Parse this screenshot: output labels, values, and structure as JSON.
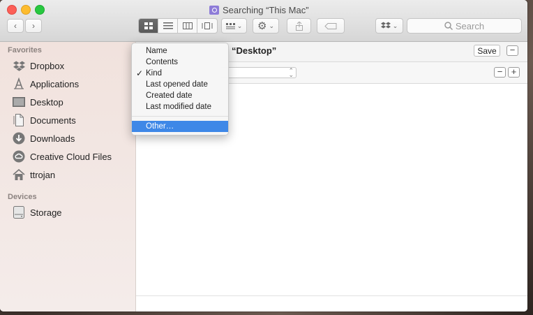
{
  "window": {
    "title": "Searching “This Mac”"
  },
  "toolbar": {
    "search_placeholder": "Search",
    "icons": [
      "back-icon",
      "forward-icon",
      "icon-view-icon",
      "list-view-icon",
      "column-view-icon",
      "coverflow-view-icon",
      "arrange-icon",
      "action-gear-icon",
      "share-icon",
      "tag-icon",
      "dropbox-icon",
      "search-icon"
    ]
  },
  "sidebar": {
    "favorites_label": "Favorites",
    "favorites": [
      {
        "label": "Dropbox",
        "icon": "dropbox-icon"
      },
      {
        "label": "Applications",
        "icon": "applications-icon"
      },
      {
        "label": "Desktop",
        "icon": "desktop-icon"
      },
      {
        "label": "Documents",
        "icon": "documents-icon"
      },
      {
        "label": "Downloads",
        "icon": "downloads-icon"
      },
      {
        "label": "Creative Cloud Files",
        "icon": "creative-cloud-icon"
      },
      {
        "label": "ttrojan",
        "icon": "home-icon"
      }
    ],
    "devices_label": "Devices",
    "devices": [
      {
        "label": "Storage",
        "icon": "disk-icon"
      }
    ]
  },
  "scope": {
    "location": "“Desktop”",
    "save_label": "Save",
    "remove_label": "−"
  },
  "criteria": {
    "remove_label": "−",
    "add_label": "+"
  },
  "attribute_menu": {
    "items": [
      "Name",
      "Contents",
      "Kind",
      "Last opened date",
      "Created date",
      "Last modified date"
    ],
    "checked": "Kind",
    "other": "Other…"
  },
  "colors": {
    "selection": "#3e88e7",
    "sidebar_bg": "#f1e2dd"
  }
}
